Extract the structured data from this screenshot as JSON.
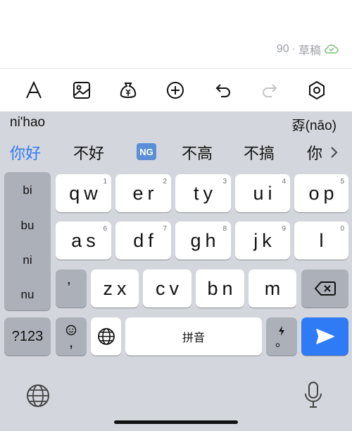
{
  "status": {
    "word_count": "90",
    "separator": "·",
    "draft_label": "草稿"
  },
  "toolbar": {
    "icons": [
      "text-format-icon",
      "image-icon",
      "money-bag-icon",
      "add-circle-icon",
      "undo-icon",
      "redo-icon",
      "settings-icon"
    ]
  },
  "candidates": {
    "pinyin": "ni'hao",
    "lookup": "孬(nāo)",
    "items": [
      "你好",
      "不好",
      "NG",
      "不高",
      "不搞",
      "你"
    ],
    "selected_color": "#2f7bf5"
  },
  "side_column": [
    "bi",
    "bu",
    "ni",
    "nu"
  ],
  "keyboard": {
    "row1": [
      {
        "label": "qw",
        "num": "1"
      },
      {
        "label": "er",
        "num": "2"
      },
      {
        "label": "ty",
        "num": "3"
      },
      {
        "label": "ui",
        "num": "4"
      },
      {
        "label": "op",
        "num": "5"
      }
    ],
    "row2": [
      {
        "label": "as",
        "num": "6"
      },
      {
        "label": "df",
        "num": "7"
      },
      {
        "label": "gh",
        "num": "8"
      },
      {
        "label": "jk",
        "num": "9"
      },
      {
        "label": "l",
        "num": "0"
      }
    ],
    "row3": [
      {
        "label": "ʼ"
      },
      {
        "label": "zx"
      },
      {
        "label": "cv"
      },
      {
        "label": "bn"
      },
      {
        "label": "m"
      }
    ],
    "numbers_key": "?123",
    "emoji_comma": ",",
    "space_label": "拼音",
    "period_label": "。",
    "send_color": "#2f7bf5"
  }
}
